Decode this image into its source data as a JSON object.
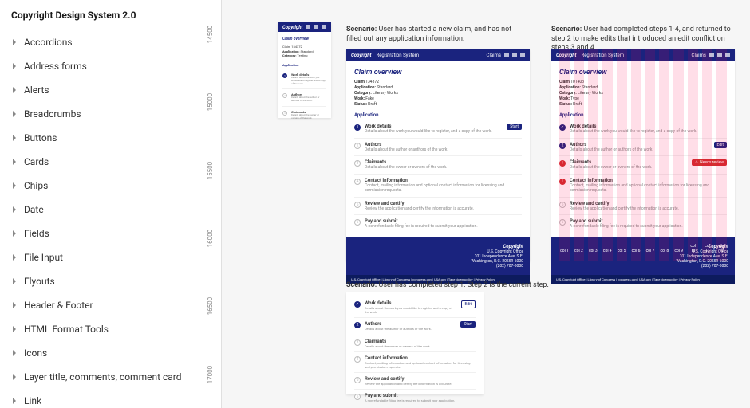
{
  "sidebar": {
    "title": "Copyright Design System 2.0",
    "items": [
      {
        "label": "Accordions"
      },
      {
        "label": "Address forms"
      },
      {
        "label": "Alerts"
      },
      {
        "label": "Breadcrumbs"
      },
      {
        "label": "Buttons"
      },
      {
        "label": "Cards"
      },
      {
        "label": "Chips"
      },
      {
        "label": "Date"
      },
      {
        "label": "Fields"
      },
      {
        "label": "File Input"
      },
      {
        "label": "Flyouts"
      },
      {
        "label": "Header & Footer"
      },
      {
        "label": "HTML Format Tools"
      },
      {
        "label": "Icons"
      },
      {
        "label": "Layer title, comments, comment card"
      },
      {
        "label": "Link"
      }
    ]
  },
  "ruler": [
    "14500",
    "15000",
    "15500",
    "16000",
    "16500",
    "17000"
  ],
  "scenarios": {
    "a": {
      "prefix": "Scenario:",
      "text": " User has started a new claim, and has not filled out any application information."
    },
    "b": {
      "prefix": "Scenario:",
      "text": " User had completed steps 1-4, and returned to step 2 to make edits that introduced an edit conflict on steps 3 and 4."
    },
    "c": {
      "prefix": "Scenario:",
      "text": " User has completed step 1. Step 2 is the current step."
    }
  },
  "app": {
    "brand": "Copyright",
    "nav": "Registration System",
    "navClaims": "Claims",
    "title": "Claim overview",
    "claim_label": "Claim",
    "claim_num_a": "134372",
    "claim_num_b": "101403",
    "application_label": "Application:",
    "application_val": "Standard",
    "application_val_b": "Standard",
    "category_label": "Category:",
    "category_val": "Literary Works",
    "category_val_b": "Literary Works",
    "work_label": "Work:",
    "work_val": "Fake",
    "work_val_b": "Type",
    "status_label": "Status:",
    "status_val": "Draft",
    "section_hdr": "Application",
    "steps": {
      "s1": {
        "title": "Work details",
        "desc": "Details about the work you would like to register, and a copy of the work."
      },
      "s2": {
        "title": "Authors",
        "desc": "Details about the author or authors of the work."
      },
      "s3": {
        "title": "Claimants",
        "desc": "Details about the owner or owners of the work."
      },
      "s4": {
        "title": "Contact information",
        "desc": "Contact, mailing information and optional contact information for licensing and permission requests."
      },
      "s5": {
        "title": "Review and certify",
        "desc": "Review the application and certify the information is accurate."
      },
      "s6": {
        "title": "Pay and submit",
        "desc": "A nonrefundable filing fee is required to submit your application."
      }
    },
    "start": "Start",
    "edit": "Edit",
    "error_badge": "Needs review",
    "footer": {
      "brand": "Copyright",
      "office": "U.S. Copyright Office",
      "addr1": "101 Independence Ave. S.E.",
      "addr2": "Washington, D.C. 20559-6000",
      "phone": "(202) 707-3000",
      "barLeft": "U.S. Copyright Office | Library of Congress | congress.gov | USA.gov | Take down policy | Privacy Policy",
      "barRight": "col 9   col 10   col 11   col 12"
    }
  },
  "cols": [
    "col 1",
    "col 2",
    "col 3",
    "col 4",
    "col 5",
    "col 6",
    "col 7",
    "col 8",
    "col 9",
    "col 10",
    "col 11",
    "col 12"
  ]
}
